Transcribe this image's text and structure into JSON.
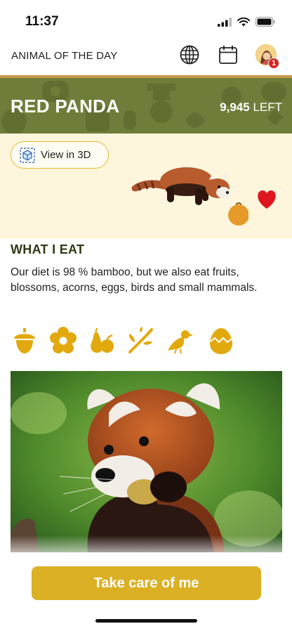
{
  "status_bar": {
    "time": "11:37"
  },
  "header": {
    "title": "ANIMAL OF THE DAY",
    "notification_count": "1"
  },
  "banner": {
    "animal_name": "RED PANDA",
    "count": "9,945",
    "count_suffix": "LEFT"
  },
  "hero": {
    "view_3d_label": "View in 3D"
  },
  "diet": {
    "heading": "WHAT I EAT",
    "description": "Our diet is 98 % bamboo, but we also eat fruits, blossoms, acorns, eggs, birds and small mammals.",
    "icons": [
      "acorn-icon",
      "blossom-icon",
      "fruits-icon",
      "bamboo-icon",
      "bird-icon",
      "egg-icon"
    ]
  },
  "cta": {
    "label": "Take care of me"
  },
  "colors": {
    "banner_green": "#6f7d3a",
    "accent_gold": "#dcb024",
    "cream": "#fdf6dc",
    "heart_red": "#e0161e"
  }
}
